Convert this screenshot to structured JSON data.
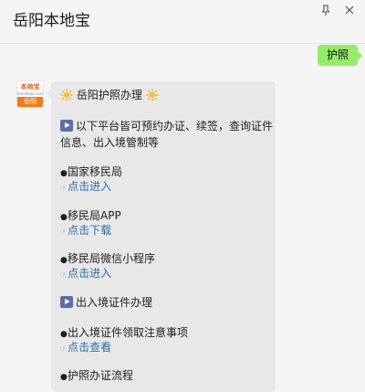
{
  "window": {
    "title": "岳阳本地宝",
    "pin_icon": "pin-icon",
    "close_icon": "close-icon"
  },
  "outgoing": {
    "text": "护照"
  },
  "sender": {
    "avatar_top": "本地宝",
    "avatar_sub": "bendibao.com",
    "avatar_bottom": "岳阳"
  },
  "message": {
    "heading": "岳阳护照办理",
    "intro_line1": "以下平台皆可预约办证、续签，查询证件",
    "intro_line2": "信息、出入境管制等",
    "items": [
      {
        "label": "国家移民局",
        "link": "点击进入"
      },
      {
        "label": "移民局APP",
        "link": "点击下载"
      },
      {
        "label": "移民局微信小程序",
        "link": "点击进入"
      }
    ],
    "section2": "出入境证件办理",
    "items2": [
      {
        "label": "出入境证件领取注意事项",
        "link": "点击查看"
      },
      {
        "label": "护照办证流程",
        "link": ""
      }
    ]
  },
  "colors": {
    "background": "#f5f5f5",
    "outgoing_bubble": "#95ec69",
    "incoming_bubble": "#e8e8e8",
    "link": "#2f6ea8",
    "avatar_accent": "#f07a1e"
  }
}
